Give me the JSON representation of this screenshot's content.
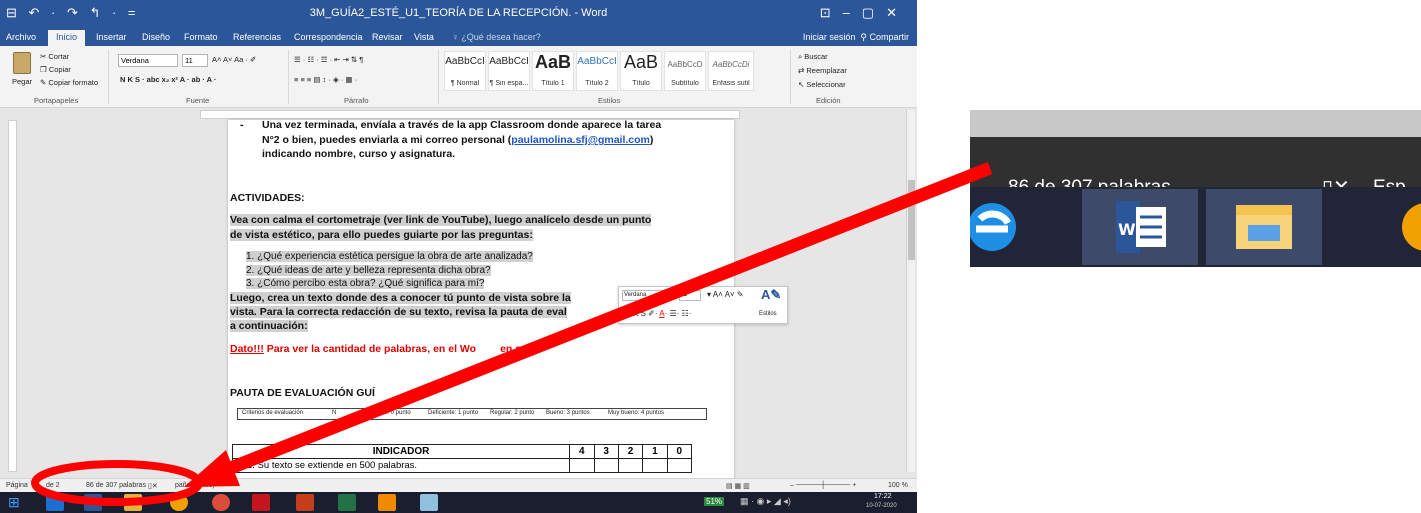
{
  "window": {
    "title": "3M_GUÍA2_ESTÉ_U1_TEORÍA DE LA RECEPCIÓN. - Word",
    "qat": "⊟ ↶ · ↷ ↰ · ="
  },
  "menu": {
    "tabs": [
      "Archivo",
      "Inicio",
      "Insertar",
      "Diseño",
      "Formato",
      "Referencias",
      "Correspondencia",
      "Revisar",
      "Vista"
    ],
    "tell_me": "¿Qué desea hacer?",
    "signin": "Iniciar sesión",
    "share": "Compartir"
  },
  "ribbon": {
    "clipboard": {
      "paste": "Pegar",
      "cut": "Cortar",
      "copy": "Copiar",
      "format_painter": "Copiar formato",
      "label": "Portapapeles"
    },
    "font": {
      "name": "Verdana",
      "size": "11",
      "label": "Fuente",
      "format_row": "N  K  S  ·  abc  x₂  x²  A · ab · A ·"
    },
    "paragraph": {
      "label": "Párrafo"
    },
    "styles": {
      "label": "Estilos",
      "items": [
        {
          "preview": "AaBbCcI",
          "name": "¶ Normal"
        },
        {
          "preview": "AaBbCcI",
          "name": "¶ Sin espa..."
        },
        {
          "preview": "AaB",
          "name": "Título 1"
        },
        {
          "preview": "AaBbCcI",
          "name": "Título 2"
        },
        {
          "preview": "AaB",
          "name": "Título"
        },
        {
          "preview": "AaBbCcD",
          "name": "Subtítulo"
        },
        {
          "preview": "AaBbCcDi",
          "name": "Énfasis sutil"
        }
      ]
    },
    "editing": {
      "find": "Buscar",
      "replace": "Reemplazar",
      "select": "Seleccionar",
      "label": "Edición"
    }
  },
  "document": {
    "line1": "Una vez terminada, envíala a través de la app Classroom donde aparece la tarea",
    "line2": "N°2 o bien, puedes enviarla a mi correo personal (",
    "email": "paulamolina.sfj@gmail.com",
    "line2_end": ")",
    "line3": "indicando nombre, curso y asignatura.",
    "activities_heading": "ACTIVIDADES:",
    "intro1": "Vea con calma el cortometraje (ver link de YouTube), luego analícelo desde un punto",
    "intro2": "de vista estético, para ello puedes guiarte por las preguntas:",
    "questions": [
      "1.  ¿Qué experiencia estética persigue la obra de arte analizada?",
      "2.  ¿Qué ideas de arte y belleza representa dicha obra?",
      "3.  ¿Cómo percibo esta obra? ¿Qué significa para mí?"
    ],
    "then1": "Luego, crea un texto donde des a conocer tú punto de vista sobre la",
    "then2": "vista. Para la correcta redacción de su texto, revisa la pauta de eval",
    "then3": "a continuación:",
    "dato_label": "Dato!!!",
    "dato_text": " Para ver la cantidad de palabras, en el Wo",
    "dato_end": "en aquí:",
    "pauta_heading": "PAUTA DE EVALUACIÓN GUÍ",
    "criteria": [
      "Criterios de evaluación",
      "N",
      "o: 0 punto",
      "Deficiente: 1 punto",
      "Regular: 2 punto",
      "Bueno: 3 puntos",
      "Muy bueno: 4 puntos"
    ],
    "table_header": [
      "INDICADOR",
      "4",
      "3",
      "2",
      "1",
      "0"
    ],
    "table_rows": [
      "1.  Su texto se extiende en 500 palabras."
    ]
  },
  "mini_toolbar": {
    "font": "Verdana",
    "size": "11",
    "styles_label": "Estilos"
  },
  "status": {
    "page": "Página",
    "page_of": "de 2",
    "words": "86 de 307 palabras",
    "lang": "pañol (Chile)",
    "zoom": "100 %"
  },
  "taskbar": {
    "battery": "51%",
    "time": "17:22",
    "date": "10-07-2020"
  },
  "zoom_inset": {
    "words": "86 de 307 palabras",
    "lang": "Esp"
  },
  "colors": {
    "word_blue": "#2b579a",
    "annotation_red": "#ff0000",
    "taskbar": "#1b1e2e"
  }
}
